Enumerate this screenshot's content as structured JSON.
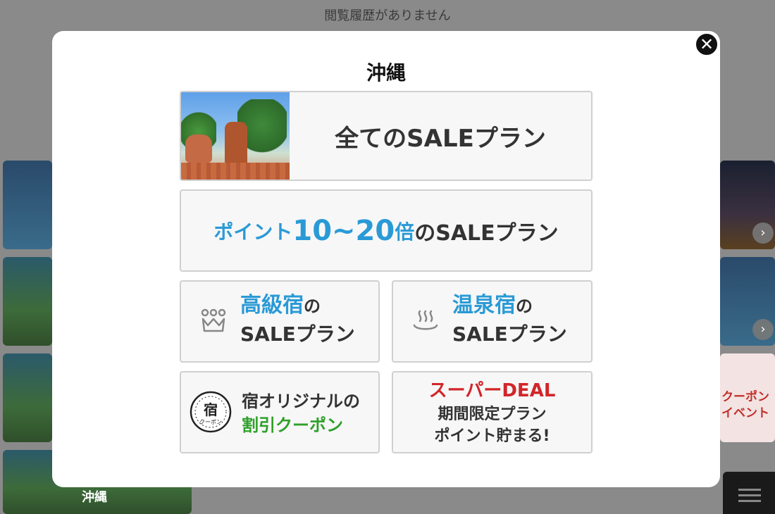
{
  "background": {
    "history_text": "閲覧履歴がありません",
    "caption_okinawa": "沖縄",
    "coupon_line1": "クーポン",
    "coupon_line2": "イベント"
  },
  "modal": {
    "title": "沖縄",
    "close_label": "✕",
    "cards": {
      "all_sale": "全てのSALEプラン",
      "points_prefix": "ポイント",
      "points_number": "10~20",
      "points_mid": "倍",
      "points_suffix": "のSALEプラン",
      "luxury_highlight": "高級宿",
      "luxury_no": "の",
      "luxury_line2": "SALEプラン",
      "onsen_highlight": "温泉宿",
      "onsen_no": "の",
      "onsen_line2": "SALEプラン",
      "coupon_line1": "宿オリジナルの",
      "coupon_line2": "割引クーポン",
      "coupon_badge_char": "宿",
      "coupon_badge_sub": "クーポン",
      "deal_line1": "スーパーDEAL",
      "deal_line2": "期間限定プラン",
      "deal_line3": "ポイント貯まる!"
    }
  },
  "colors": {
    "accent_blue": "#2a9ad6",
    "coupon_green": "#2fa02a",
    "deal_red": "#d2262a"
  },
  "icons": {
    "close": "close-icon",
    "luxury": "crown-icon",
    "onsen": "hot-spring-icon",
    "coupon": "coupon-badge-icon",
    "menu": "hamburger-menu-icon",
    "arrow": "chevron-right-icon"
  }
}
